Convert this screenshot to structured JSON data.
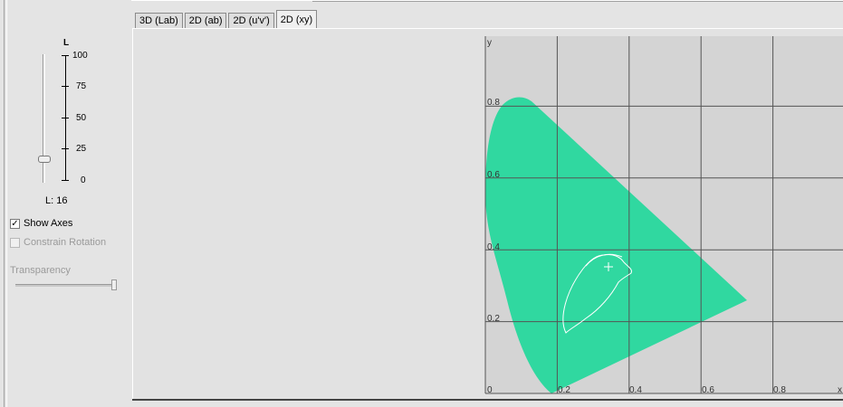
{
  "lightness": {
    "title": "L",
    "ticks": [
      "100",
      "75",
      "50",
      "25",
      "0"
    ],
    "value_label": "L: 16",
    "value": 16
  },
  "options": {
    "show_axes": {
      "label": "Show Axes",
      "checked": true
    },
    "constrain_rotation": {
      "label": "Constrain Rotation",
      "checked": false
    }
  },
  "transparency": {
    "label": "Transparency",
    "value": 1.0
  },
  "tabs": [
    {
      "label": "3D (Lab)",
      "active": false
    },
    {
      "label": "2D (ab)",
      "active": false
    },
    {
      "label": "2D (u'v')",
      "active": false
    },
    {
      "label": "2D (xy)",
      "active": true
    }
  ],
  "plot": {
    "x_axis_label": "x",
    "y_axis_label": "y",
    "x_ticks": [
      "0",
      "0.2",
      "0.4",
      "0.6",
      "0.8"
    ],
    "y_ticks": [
      "0.8",
      "0.6",
      "0.4",
      "0.2"
    ],
    "x_range": [
      0,
      1.0
    ],
    "y_range": [
      0,
      1.0
    ],
    "grid": true,
    "plot_background": "#d4d4d4",
    "gamut_outline_color": "#ffffff"
  }
}
